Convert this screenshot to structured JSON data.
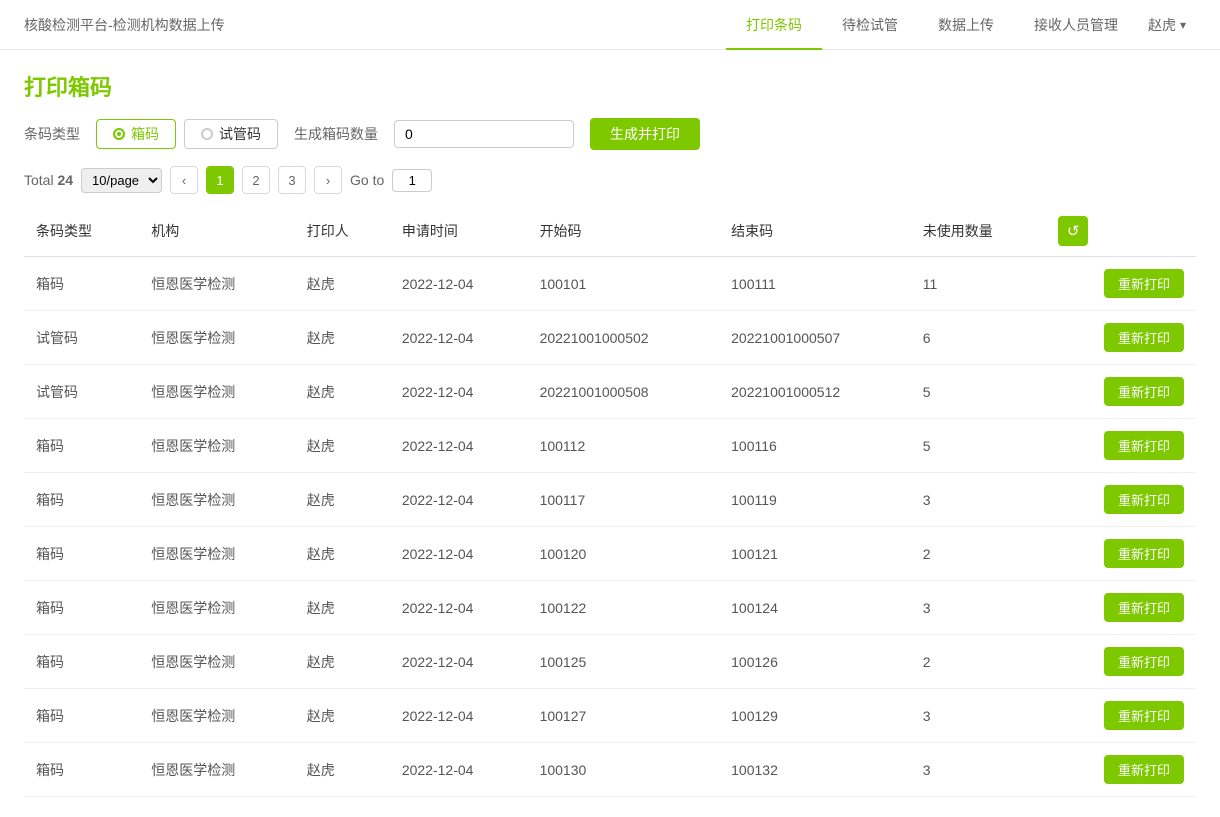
{
  "header": {
    "title": "核酸检测平台-检测机构数据上传",
    "nav": [
      {
        "label": "打印条码",
        "active": true
      },
      {
        "label": "待检试管",
        "active": false
      },
      {
        "label": "数据上传",
        "active": false
      },
      {
        "label": "接收人员管理",
        "active": false
      }
    ],
    "user": "赵虎"
  },
  "page": {
    "title": "打印箱码"
  },
  "filter": {
    "barcode_type_label": "条码类型",
    "options": [
      {
        "label": "箱码",
        "active": true
      },
      {
        "label": "试管码",
        "active": false
      }
    ],
    "quantity_label": "生成箱码数量",
    "quantity_value": "0",
    "quantity_placeholder": "0",
    "generate_btn": "生成并打印"
  },
  "pagination": {
    "total_label": "Total",
    "total": "24",
    "page_size": "10/page",
    "pages": [
      "1",
      "2",
      "3"
    ],
    "active_page": "1",
    "goto_label": "Go to",
    "goto_value": "1",
    "prev_icon": "‹",
    "next_icon": "›"
  },
  "table": {
    "columns": [
      "条码类型",
      "机构",
      "打印人",
      "申请时间",
      "开始码",
      "结束码",
      "未使用数量",
      ""
    ],
    "refresh_icon": "↺",
    "reprint_label": "重新打印",
    "rows": [
      {
        "type": "箱码",
        "org": "恒恩医学检测",
        "printer": "赵虎",
        "time": "2022-12-04",
        "start": "100101",
        "end": "100111",
        "unused": "11"
      },
      {
        "type": "试管码",
        "org": "恒恩医学检测",
        "printer": "赵虎",
        "time": "2022-12-04",
        "start": "20221001000502",
        "end": "20221001000507",
        "unused": "6"
      },
      {
        "type": "试管码",
        "org": "恒恩医学检测",
        "printer": "赵虎",
        "time": "2022-12-04",
        "start": "20221001000508",
        "end": "20221001000512",
        "unused": "5"
      },
      {
        "type": "箱码",
        "org": "恒恩医学检测",
        "printer": "赵虎",
        "time": "2022-12-04",
        "start": "100112",
        "end": "100116",
        "unused": "5"
      },
      {
        "type": "箱码",
        "org": "恒恩医学检测",
        "printer": "赵虎",
        "time": "2022-12-04",
        "start": "100117",
        "end": "100119",
        "unused": "3"
      },
      {
        "type": "箱码",
        "org": "恒恩医学检测",
        "printer": "赵虎",
        "time": "2022-12-04",
        "start": "100120",
        "end": "100121",
        "unused": "2"
      },
      {
        "type": "箱码",
        "org": "恒恩医学检测",
        "printer": "赵虎",
        "time": "2022-12-04",
        "start": "100122",
        "end": "100124",
        "unused": "3"
      },
      {
        "type": "箱码",
        "org": "恒恩医学检测",
        "printer": "赵虎",
        "time": "2022-12-04",
        "start": "100125",
        "end": "100126",
        "unused": "2"
      },
      {
        "type": "箱码",
        "org": "恒恩医学检测",
        "printer": "赵虎",
        "time": "2022-12-04",
        "start": "100127",
        "end": "100129",
        "unused": "3"
      },
      {
        "type": "箱码",
        "org": "恒恩医学检测",
        "printer": "赵虎",
        "time": "2022-12-04",
        "start": "100130",
        "end": "100132",
        "unused": "3"
      }
    ]
  }
}
